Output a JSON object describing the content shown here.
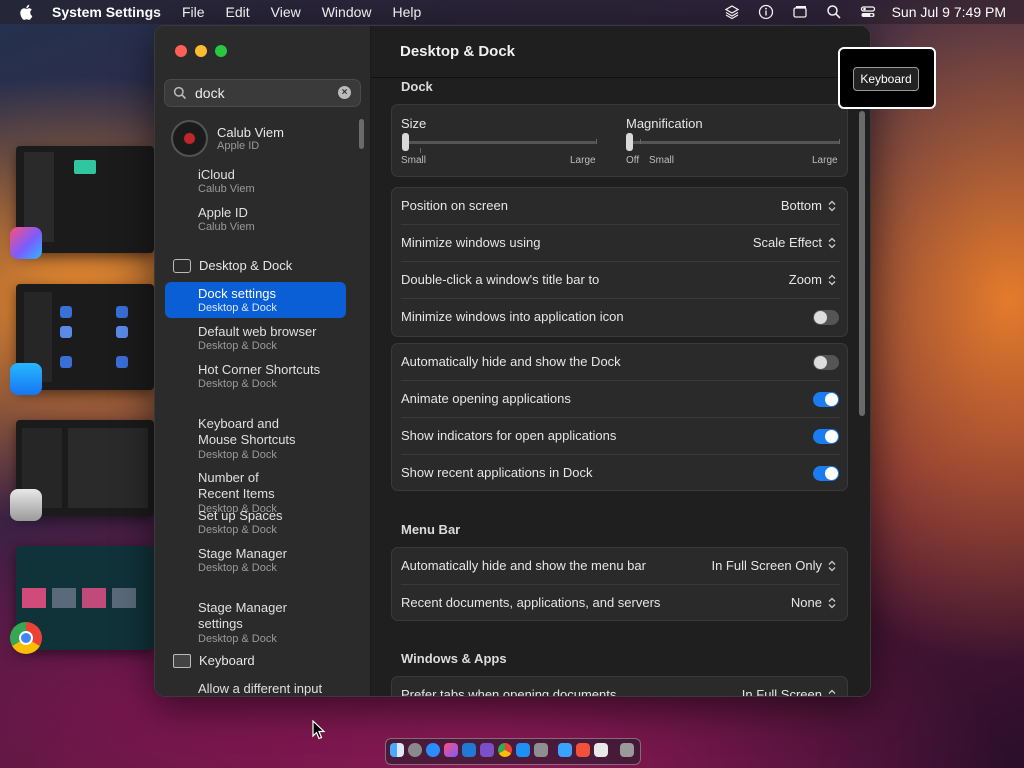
{
  "menubar": {
    "app_name": "System Settings",
    "items": [
      "File",
      "Edit",
      "View",
      "Window",
      "Help"
    ],
    "clock": "Sun Jul 9  7:49 PM"
  },
  "sidebar": {
    "search_value": "dock",
    "profile": {
      "name": "Calub Viem",
      "sub": "Apple ID"
    },
    "items": [
      {
        "label": "iCloud",
        "sub": "Calub Viem"
      },
      {
        "label": "Apple ID",
        "sub": "Calub Viem"
      }
    ],
    "section_desktop": "Desktop & Dock",
    "desktop_items": [
      {
        "label": "Dock settings",
        "sub": "Desktop & Dock"
      },
      {
        "label": "Default web browser",
        "sub": "Desktop & Dock"
      },
      {
        "label": "Hot Corner Shortcuts",
        "sub": "Desktop & Dock"
      },
      {
        "label": "Keyboard and\nMouse Shortcuts",
        "sub": "Desktop & Dock"
      },
      {
        "label": "Number of\nRecent Items",
        "sub": "Desktop & Dock"
      },
      {
        "label": "Set up Spaces",
        "sub": "Desktop & Dock"
      },
      {
        "label": "Stage Manager",
        "sub": "Desktop & Dock"
      },
      {
        "label": "Stage Manager\nsettings",
        "sub": "Desktop & Dock"
      }
    ],
    "section_keyboard": "Keyboard",
    "keyboard_items": [
      {
        "label": "Allow a different input"
      }
    ]
  },
  "main": {
    "title": "Desktop & Dock",
    "dock_heading": "Dock",
    "size": {
      "label": "Size",
      "min": "Small",
      "max": "Large",
      "value": 0.0
    },
    "magnification": {
      "label": "Magnification",
      "off": "Off",
      "min": "Small",
      "max": "Large",
      "value": 0.0
    },
    "rows1": [
      {
        "label": "Position on screen",
        "value": "Bottom"
      },
      {
        "label": "Minimize windows using",
        "value": "Scale Effect"
      },
      {
        "label": "Double-click a window's title bar to",
        "value": "Zoom"
      },
      {
        "label": "Minimize windows into application icon",
        "toggle": false
      }
    ],
    "rows2": [
      {
        "label": "Automatically hide and show the Dock",
        "toggle": false
      },
      {
        "label": "Animate opening applications",
        "toggle": true
      },
      {
        "label": "Show indicators for open applications",
        "toggle": true
      },
      {
        "label": "Show recent applications in Dock",
        "toggle": true
      }
    ],
    "menubar_heading": "Menu Bar",
    "rows3": [
      {
        "label": "Automatically hide and show the menu bar",
        "value": "In Full Screen Only"
      },
      {
        "label": "Recent documents, applications, and servers",
        "value": "None"
      }
    ],
    "windows_heading": "Windows & Apps",
    "rows4": [
      {
        "label": "Prefer tabs when opening documents",
        "value": "In Full Screen"
      }
    ]
  },
  "keyboard_hint": {
    "label": "Keyboard"
  },
  "colors": {
    "accent": "#0a5fd6",
    "toggle_on": "#1a7cf0"
  }
}
